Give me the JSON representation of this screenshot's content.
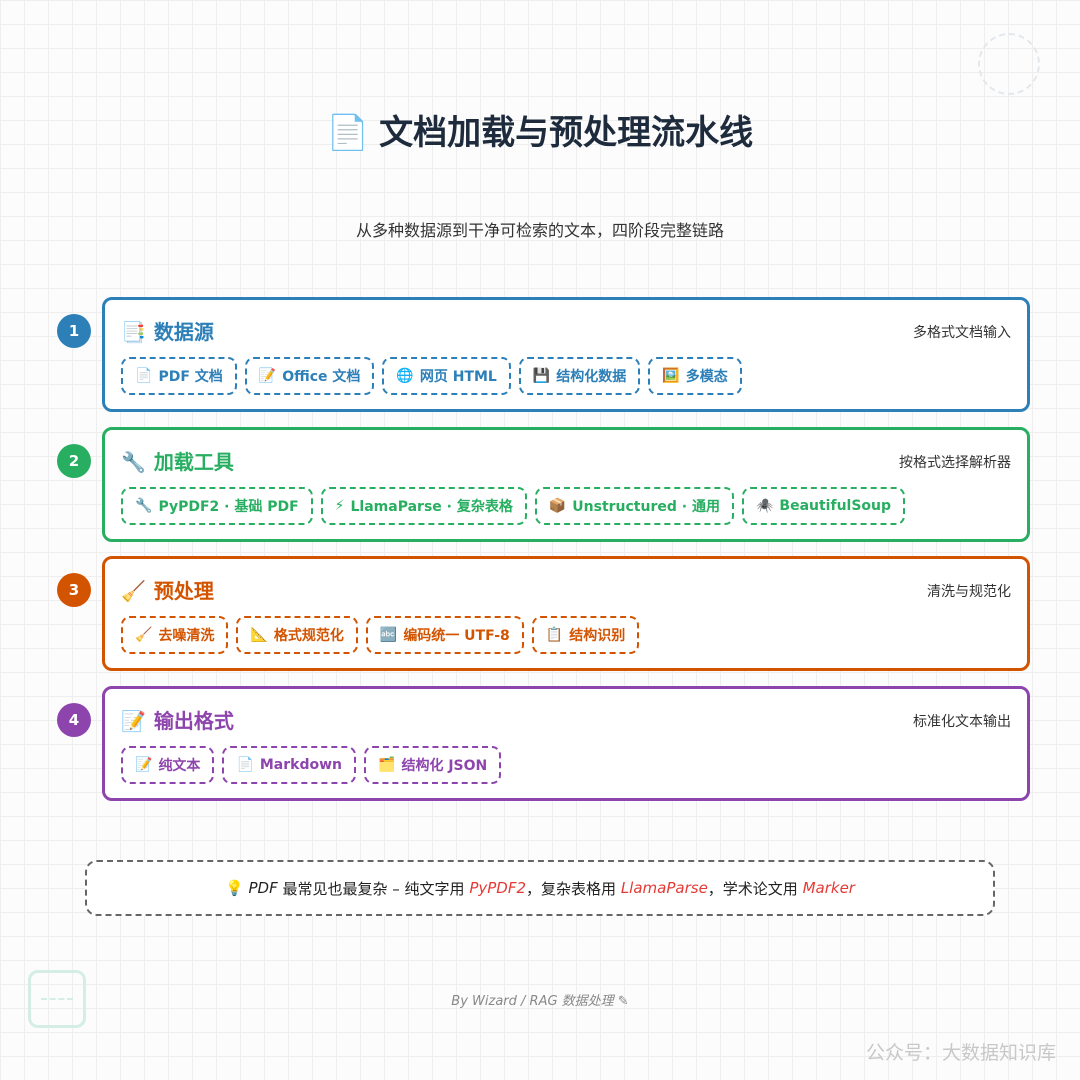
{
  "title": {
    "icon": "📄",
    "text": "文档加载与预处理流水线"
  },
  "subtitle": "从多种数据源到干净可检索的文本，四阶段完整链路",
  "colors": {
    "blue": "#2d7fb8",
    "green": "#27ae60",
    "orange": "#d35400",
    "purple": "#8e44ad"
  },
  "stages": [
    {
      "number": "1",
      "icon": "📑",
      "title": "数据源",
      "note": "多格式文档输入",
      "tags": [
        {
          "icon": "📄",
          "label": "PDF 文档"
        },
        {
          "icon": "📝",
          "label": "Office 文档"
        },
        {
          "icon": "🌐",
          "label": "网页 HTML"
        },
        {
          "icon": "💾",
          "label": "结构化数据"
        },
        {
          "icon": "🖼️",
          "label": "多模态"
        }
      ]
    },
    {
      "number": "2",
      "icon": "🔧",
      "title": "加载工具",
      "note": "按格式选择解析器",
      "tags": [
        {
          "icon": "🔧",
          "label": "PyPDF2 · 基础 PDF"
        },
        {
          "icon": "⚡",
          "label": "LlamaParse · 复杂表格"
        },
        {
          "icon": "📦",
          "label": "Unstructured · 通用"
        },
        {
          "icon": "🕷️",
          "label": "BeautifulSoup"
        }
      ]
    },
    {
      "number": "3",
      "icon": "🧹",
      "title": "预处理",
      "note": "清洗与规范化",
      "tags": [
        {
          "icon": "🧹",
          "label": "去噪清洗"
        },
        {
          "icon": "📐",
          "label": "格式规范化"
        },
        {
          "icon": "🔤",
          "label": "编码统一 UTF-8"
        },
        {
          "icon": "📋",
          "label": "结构识别"
        }
      ]
    },
    {
      "number": "4",
      "icon": "📝",
      "title": "输出格式",
      "note": "标准化文本输出",
      "tags": [
        {
          "icon": "📝",
          "label": "纯文本"
        },
        {
          "icon": "📄",
          "label": "Markdown"
        },
        {
          "icon": "🗂️",
          "label": "结构化 JSON"
        }
      ]
    }
  ],
  "tip": {
    "icon": "💡",
    "pdf": "PDF",
    "text1": "最常见也最复杂 – 纯文字用",
    "tool1": "PyPDF2",
    "text2": "，复杂表格用",
    "tool2": "LlamaParse",
    "text3": "，学术论文用",
    "tool3": "Marker"
  },
  "byline": "By Wizard / RAG 数据处理 ✎",
  "watermark": "公众号：大数据知识库"
}
